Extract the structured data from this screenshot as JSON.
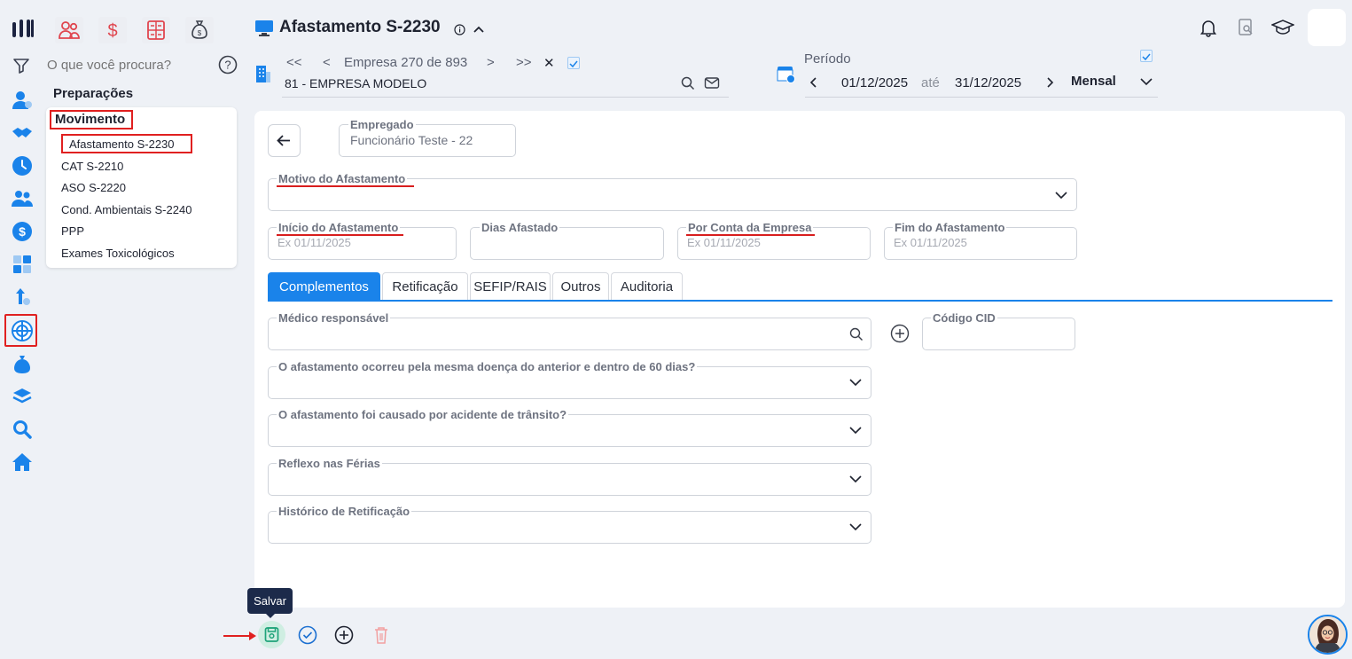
{
  "search": {
    "placeholder": "O que você procura?"
  },
  "menu": {
    "section_preparacoes": "Preparações",
    "section_movimento": "Movimento",
    "items": [
      {
        "label": "Afastamento S-2230"
      },
      {
        "label": "CAT S-2210"
      },
      {
        "label": "ASO S-2220"
      },
      {
        "label": "Cond. Ambientais S-2240"
      },
      {
        "label": "PPP"
      },
      {
        "label": "Exames Toxicológicos"
      }
    ]
  },
  "header": {
    "title": "Afastamento S-2230",
    "company_nav": {
      "first": "<<",
      "prev": "<",
      "label": "Empresa 270 de 893",
      "next": ">",
      "last": ">>",
      "close": "✕"
    },
    "company_name": "81 - EMPRESA MODELO",
    "period": {
      "label": "Período",
      "start": "01/12/2025",
      "sep": "até",
      "end": "31/12/2025",
      "mode": "Mensal"
    }
  },
  "form": {
    "empregado_label": "Empregado",
    "empregado_value": "Funcionário Teste - 22",
    "motivo_label": "Motivo do Afastamento",
    "inicio_label": "Início do Afastamento",
    "inicio_placeholder": "Ex 01/11/2025",
    "dias_label": "Dias Afastado",
    "conta_label": "Por Conta da Empresa",
    "conta_placeholder": "Ex 01/11/2025",
    "fim_label": "Fim do Afastamento",
    "fim_placeholder": "Ex 01/11/2025"
  },
  "tabs": [
    {
      "label": "Complementos"
    },
    {
      "label": "Retificação"
    },
    {
      "label": "SEFIP/RAIS"
    },
    {
      "label": "Outros"
    },
    {
      "label": "Auditoria"
    }
  ],
  "complementos": {
    "medico_label": "Médico responsável",
    "cid_label": "Código CID",
    "mesma_doenca_label": "O afastamento ocorreu pela mesma doença do anterior e dentro de 60 dias?",
    "acidente_label": "O afastamento foi causado por acidente de trânsito?",
    "reflexo_label": "Reflexo nas Férias",
    "historico_label": "Histórico de Retificação"
  },
  "footer": {
    "tooltip_save": "Salvar"
  },
  "colors": {
    "accent": "#1a83ea",
    "highlight": "#e02020",
    "save_green": "#1fa37a",
    "delete": "#f2a0a0"
  }
}
